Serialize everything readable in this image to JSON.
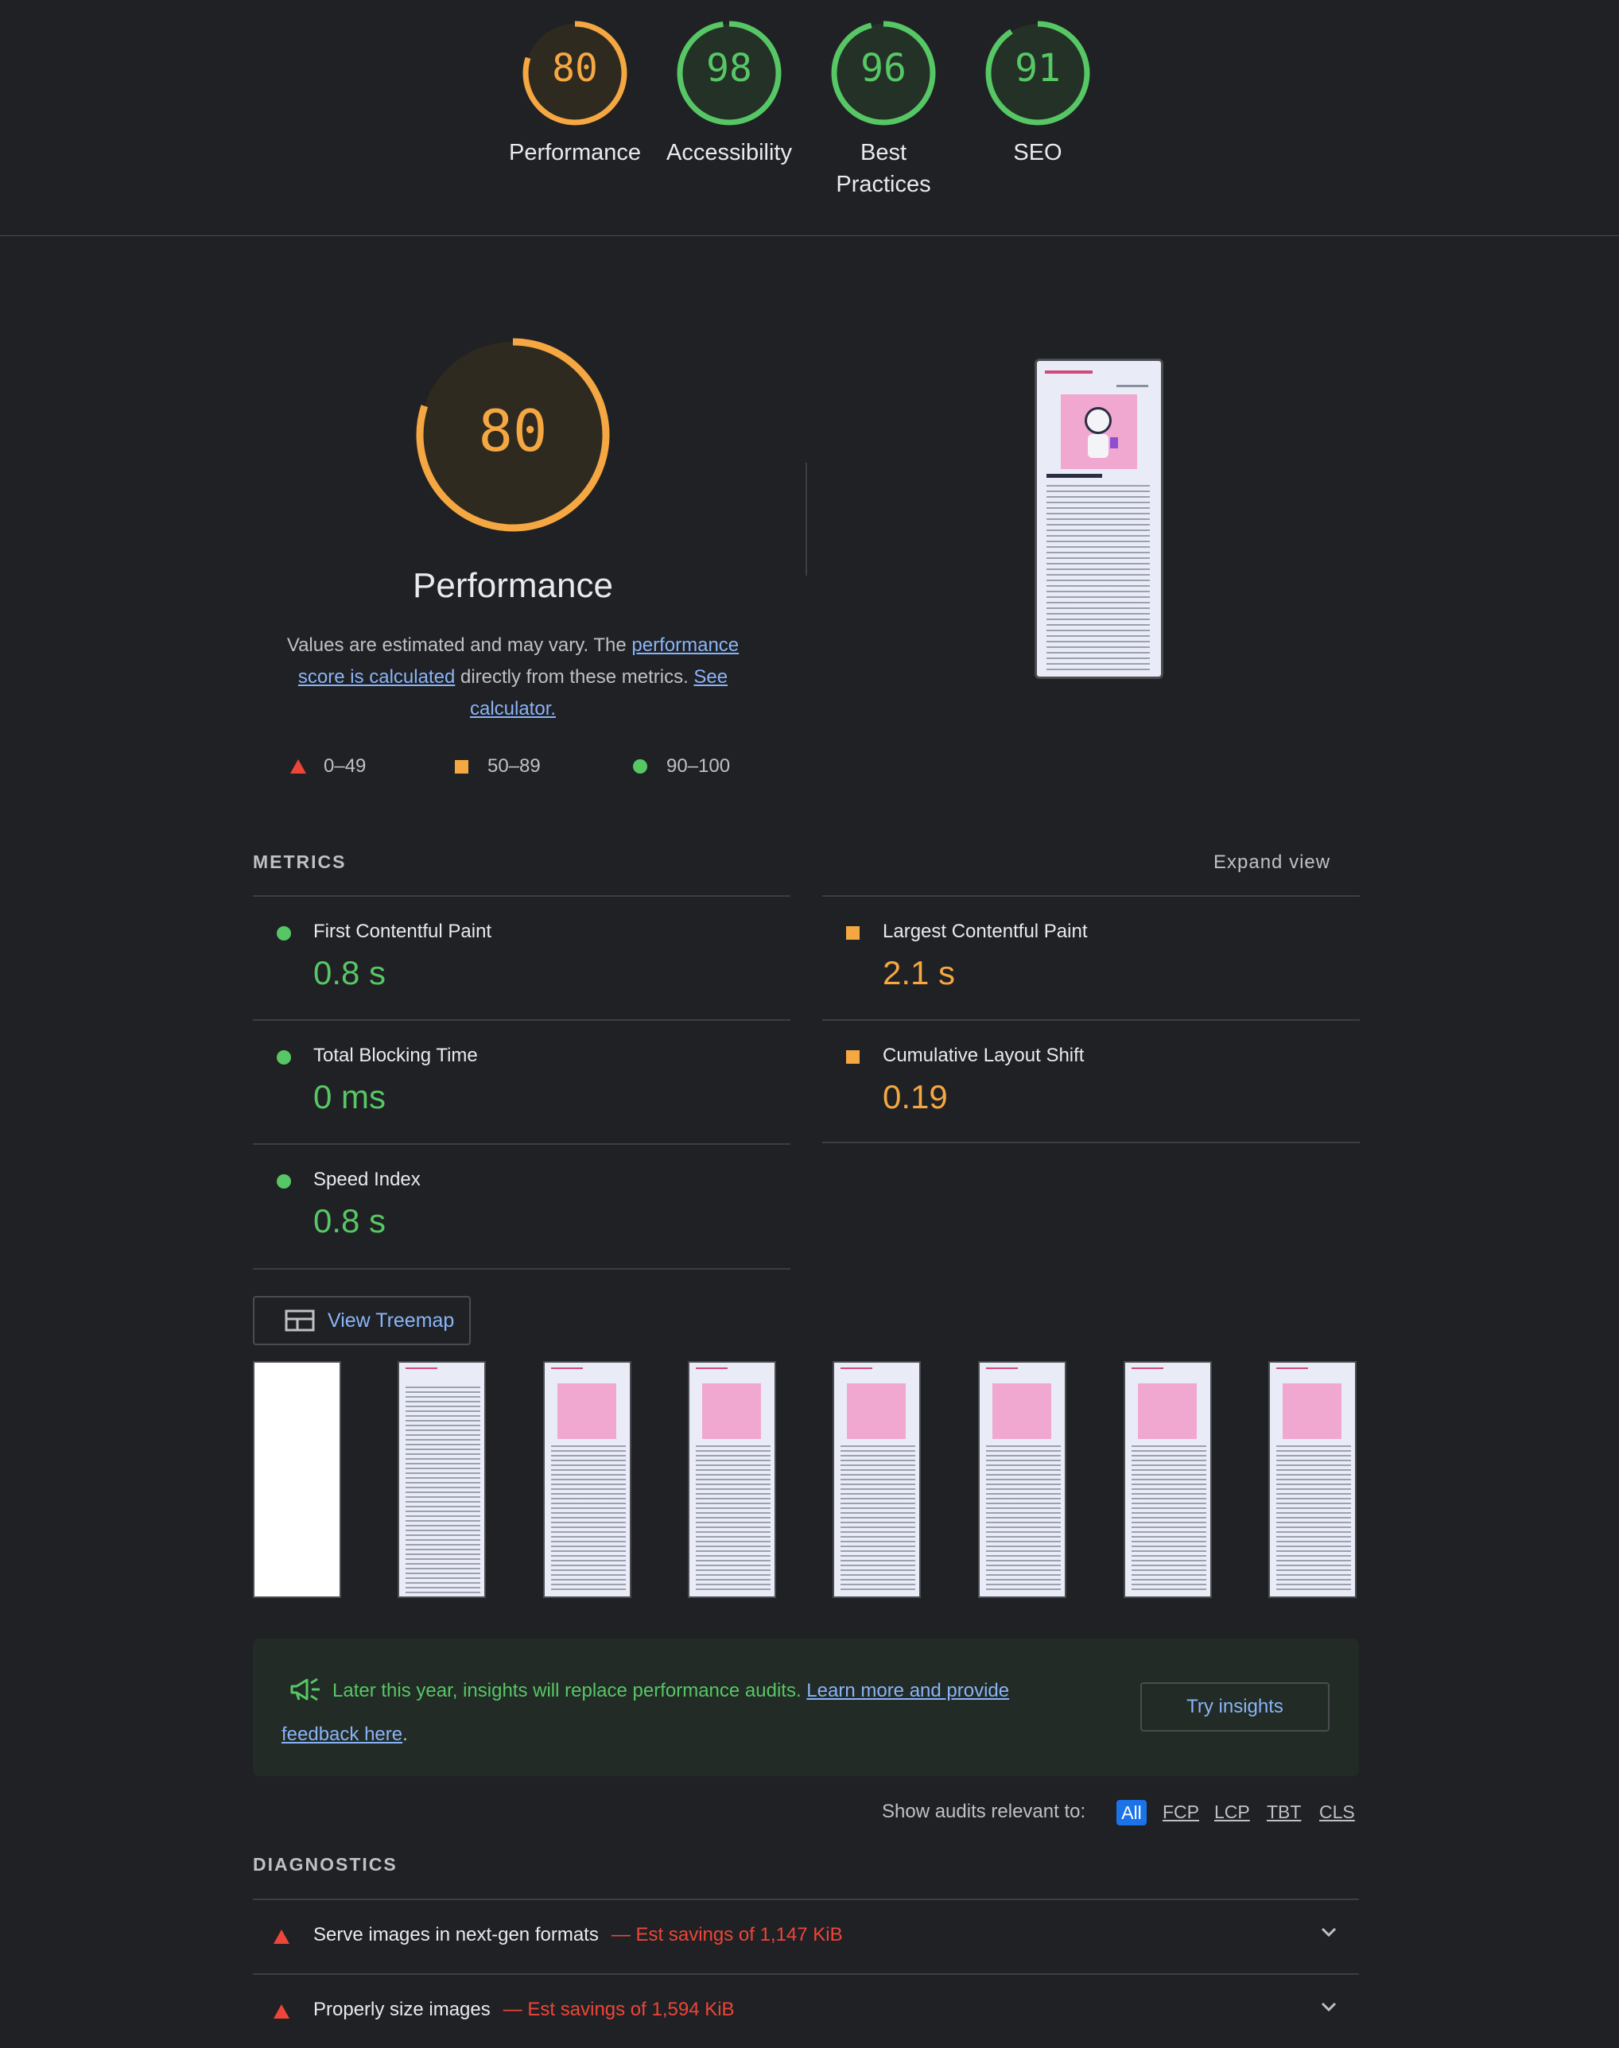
{
  "top_gauges": [
    {
      "score": "80",
      "label": "Performance",
      "color": "#f5a742"
    },
    {
      "score": "98",
      "label": "Accessibility",
      "color": "#57c765"
    },
    {
      "score": "96",
      "label": "Best Practices",
      "label_line1": "Best",
      "label_line2": "Practices",
      "color": "#57c765"
    },
    {
      "score": "91",
      "label": "SEO",
      "color": "#57c765"
    }
  ],
  "score_fractions": {
    "performance": 0.8,
    "accessibility": 0.98,
    "best_practices": 0.96,
    "seo": 0.91
  },
  "performance": {
    "score": "80",
    "title": "Performance",
    "desc_prefix": "Values are estimated and may vary. The ",
    "desc_link1": "performance score is calculated",
    "desc_mid": " directly from these metrics. ",
    "desc_link2": "See calculator.",
    "legend": [
      {
        "icon": "triangle-fail-icon",
        "range": "0–49",
        "color": "#ee4539"
      },
      {
        "icon": "square-average-icon",
        "range": "50–89",
        "color": "#f5a742"
      },
      {
        "icon": "circle-pass-icon",
        "range": "90–100",
        "color": "#57c765"
      }
    ]
  },
  "metrics": {
    "title": "METRICS",
    "expand_label": "Expand view",
    "items": [
      {
        "name": "First Contentful Paint",
        "value": "0.8 s",
        "status": "pass"
      },
      {
        "name": "Largest Contentful Paint",
        "value": "2.1 s",
        "status": "average"
      },
      {
        "name": "Total Blocking Time",
        "value": "0 ms",
        "status": "pass"
      },
      {
        "name": "Cumulative Layout Shift",
        "value": "0.19",
        "status": "average"
      },
      {
        "name": "Speed Index",
        "value": "0.8 s",
        "status": "pass"
      }
    ]
  },
  "treemap": {
    "label": "View Treemap"
  },
  "insights_banner": {
    "text": "Later this year, insights will replace performance audits. ",
    "link_line1": "Learn more and provide",
    "link_line2": "feedback here",
    "suffix": ".",
    "button": "Try insights"
  },
  "filter": {
    "label": "Show audits relevant to:",
    "options": [
      "All",
      "FCP",
      "LCP",
      "TBT",
      "CLS"
    ],
    "selected": "All"
  },
  "diagnostics": {
    "title": "DIAGNOSTICS",
    "items": [
      {
        "title": "Serve images in next-gen formats",
        "savings": "— Est savings of 1,147 KiB"
      },
      {
        "title": "Properly size images",
        "savings": "— Est savings of 1,594 KiB"
      }
    ]
  },
  "colors": {
    "pass": "#57c765",
    "average": "#f5a742",
    "fail": "#ee4539",
    "link": "#8ab4f8",
    "background": "#202124"
  }
}
